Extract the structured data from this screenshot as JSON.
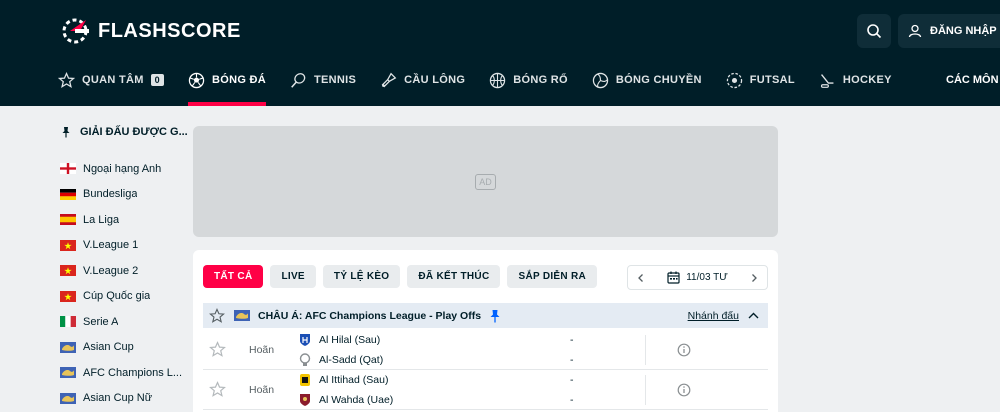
{
  "header": {
    "logo_text": "FLASHSCORE",
    "login_label": "ĐĂNG NHẬP"
  },
  "nav": {
    "items": [
      {
        "label": "QUAN TÂM",
        "icon": "star-icon",
        "count": "0"
      },
      {
        "label": "BÓNG ĐÁ",
        "icon": "soccer-ball-icon",
        "active": true
      },
      {
        "label": "TENNIS",
        "icon": "tennis-icon"
      },
      {
        "label": "CẦU LÔNG",
        "icon": "badminton-icon"
      },
      {
        "label": "BÓNG RỔ",
        "icon": "basketball-icon"
      },
      {
        "label": "BÓNG CHUYỀN",
        "icon": "volleyball-icon"
      },
      {
        "label": "FUTSAL",
        "icon": "futsal-icon"
      },
      {
        "label": "HOCKEY",
        "icon": "hockey-icon"
      }
    ],
    "more_label": "CÁC MÔN"
  },
  "sidebar": {
    "title": "GIẢI ĐẤU ĐƯỢC G...",
    "items": [
      {
        "label": "Ngoại hạng Anh",
        "flag": "england"
      },
      {
        "label": "Bundesliga",
        "flag": "germany"
      },
      {
        "label": "La Liga",
        "flag": "spain"
      },
      {
        "label": "V.League 1",
        "flag": "vietnam"
      },
      {
        "label": "V.League 2",
        "flag": "vietnam"
      },
      {
        "label": "Cúp Quốc gia",
        "flag": "vietnam"
      },
      {
        "label": "Serie A",
        "flag": "italy"
      },
      {
        "label": "Asian Cup",
        "flag": "asia"
      },
      {
        "label": "AFC Champions L...",
        "flag": "asia"
      },
      {
        "label": "Asian Cup Nữ",
        "flag": "asia"
      }
    ]
  },
  "ad": {
    "label": "AD"
  },
  "filters": [
    "TẤT CẢ",
    "LIVE",
    "TỶ LỆ KÈO",
    "ĐÃ KẾT THÚC",
    "SẮP DIỄN RA"
  ],
  "date": {
    "label": "11/03 TƯ"
  },
  "league": {
    "name": "CHÂU Á: AFC Champions League - Play Offs",
    "link": "Nhánh đấu"
  },
  "matches": [
    {
      "status": "Hoãn",
      "home": "Al Hilal (Sau)",
      "away": "Al-Sadd (Qat)",
      "home_score": "-",
      "away_score": "-"
    },
    {
      "status": "Hoãn",
      "home": "Al Ittihad (Sau)",
      "away": "Al Wahda (Uae)",
      "home_score": "-",
      "away_score": "-"
    }
  ],
  "colors": {
    "header_bg": "#001e28",
    "accent": "#ff0046",
    "league_bg": "#e4ebf3",
    "page_bg": "#eef0f2"
  }
}
